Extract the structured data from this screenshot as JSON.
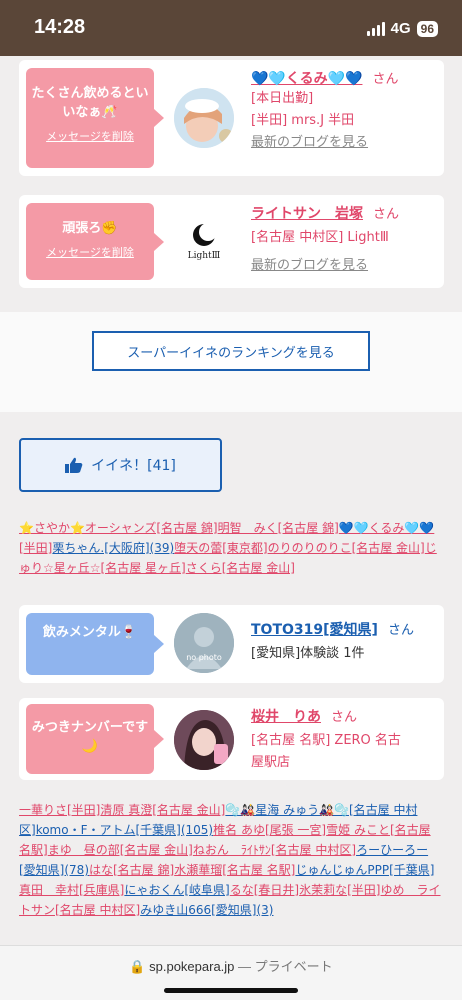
{
  "status_bar": {
    "time": "14:28",
    "network": "4G",
    "battery": "96"
  },
  "cards": [
    {
      "message": "たくさん飲めるといいなぁ🥂",
      "delete_label": "メッセージを削除",
      "name": "💙🩵くるみ🩵💙",
      "san": "さん",
      "line1": "[本日出勤]",
      "line2": "[半田] mrs.J 半田",
      "blog": "最新のブログを見る"
    },
    {
      "message": "頑張ろ✊",
      "delete_label": "メッセージを削除",
      "name": "ライトサン　岩塚",
      "san": "さん",
      "line1": "[名古屋 中村区] LightⅢ",
      "blog": "最新のブログを見る",
      "logo_text": "LightⅢ"
    },
    {
      "message": "飲みメンタル🍷",
      "name": "TOTO319[愛知県]",
      "san": "さん",
      "line1": "[愛知県]体験談 1件",
      "avatar_text": "no photo"
    },
    {
      "message": "みつきナンバーです🌙",
      "name": "桜井　りあ",
      "san": "さん",
      "line1": "[名古屋 名駅] ZERO 名古",
      "line2": "屋駅店"
    }
  ],
  "ranking_button": "スーパーイイネのランキングを見る",
  "iine_button": {
    "label": "イイネ！[41]"
  },
  "names_block_1": [
    "⭐さやか⭐オーシャンズ[名古屋 錦]",
    "明智　みく[名古屋 錦]",
    "💙🩵くるみ🩵💙[半田]",
    "栗ちゃん.[大阪府](39)",
    "堕天の蕾[東京都]",
    "のりのりのりこ[名古屋 金山]",
    "じゅり☆星ヶ丘☆[名古屋 星ヶ丘]",
    "さくら[名古屋 金山]"
  ],
  "names_block_2": [
    "一華りさ[半田]",
    "清原 真澄[名古屋 金山]",
    "🫧🎎星海 みゅう🎎🫧[名古屋 中村区]",
    "komo・F・アトム[千葉県](105)",
    "椎名 あゆ[尾張 一宮]",
    "雪姫 みこと[名古屋 名駅]",
    "まゆ　昼の部[名古屋 金山]",
    "ねおん　ﾗｲﾄｻﾝ[名古屋 中村区]",
    "ろーひーろー[愛知県](78)",
    "はな[名古屋 錦]",
    "水瀬華瑠[名古屋 名駅]",
    "じゅんじゅんPPP[千葉県]",
    "真田　幸村[兵庫県]",
    "にゃおくん[岐阜県]",
    "るな[春日井]",
    "氷茉莉な[半田]",
    "ゆめ　ライトサン[名古屋 中村区]",
    "みゆき山666[愛知県](3)"
  ],
  "browser": {
    "domain": "sp.pokepara.jp",
    "separator": "—",
    "mode": "プライベート"
  },
  "colors": {
    "accent_pink": "#e0476a",
    "link_blue": "#1b5fb0",
    "header_brown": "#5a4638"
  }
}
